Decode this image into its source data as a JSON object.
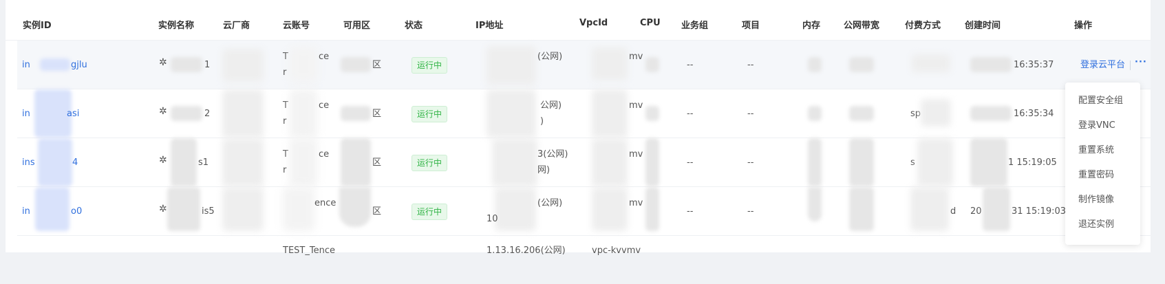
{
  "columns": {
    "instance_id": "实例ID",
    "instance_name": "实例名称",
    "cloud_vendor": "云厂商",
    "cloud_account": "云账号",
    "zone": "可用区",
    "status": "状态",
    "ip": "IP地址",
    "vpc_id": "VpcId",
    "cpu": "CPU",
    "business_group": "业务组",
    "project": "项目",
    "memory": "内存",
    "bandwidth": "公网带宽",
    "billing": "付费方式",
    "created": "创建时间",
    "actions": "操作"
  },
  "rows": [
    {
      "id": "in",
      "id_tail": "gjlu",
      "name_tail": "1",
      "account_top": "T",
      "account_top_tail": "ce",
      "account_bottom": "r",
      "zone_tail": "区",
      "status": "运行中",
      "ip_line1_tail": "(公网)",
      "ip_line2": "",
      "vpc_line1_tail": "mv",
      "vpc_line2": "",
      "business_group": "--",
      "project": "--",
      "billing_prefix": "",
      "created_prefix": "",
      "created_tail": "16:35:37",
      "action_label": "登录云平台"
    },
    {
      "id": "in",
      "id_tail": "asi",
      "name_tail": "2",
      "account_top": "T",
      "account_top_tail": "ce",
      "account_bottom": "r",
      "zone_tail": "区",
      "status": "运行中",
      "ip_line1_tail": "公网)",
      "ip_line2": ")",
      "vpc_line1_tail": "mv",
      "vpc_line2": "",
      "business_group": "--",
      "project": "--",
      "billing_prefix": "sp",
      "created_prefix": "",
      "created_tail": "16:35:34",
      "action_label": ""
    },
    {
      "id": "ins",
      "id_tail": "4",
      "name_tail": "s1",
      "account_top": "T",
      "account_top_tail": "ce",
      "account_bottom": "r",
      "zone_tail": "区",
      "status": "运行中",
      "ip_line1_tail": "3(公网)",
      "ip_line2": "网)",
      "vpc_line1_tail": "mv",
      "vpc_line2": "",
      "business_group": "--",
      "project": "--",
      "billing_prefix": "s",
      "created_prefix": "",
      "created_tail": "1 15:19:05",
      "action_label": ""
    },
    {
      "id": "in",
      "id_tail": "o0",
      "name_tail": "is5",
      "account_top": "",
      "account_top_tail": "ence",
      "account_bottom": "",
      "zone_tail": "区",
      "status": "运行中",
      "ip_line1_tail": "(公网)",
      "ip_line2": "10",
      "vpc_line1_tail": "mv",
      "vpc_line2": "",
      "business_group": "--",
      "project": "--",
      "billing_prefix": "d",
      "created_prefix": "20",
      "created_tail": "31 15:19:03",
      "action_label": ""
    }
  ],
  "partial_row": {
    "account": "TEST_Tence",
    "ip": "1.13.16.206(公网)",
    "vpc": "vpc-kvvmv"
  },
  "dropdown": {
    "items": [
      "配置安全组",
      "登录VNC",
      "重置系统",
      "重置密码",
      "制作镜像",
      "退还实例"
    ]
  },
  "more_label": "···",
  "colors": {
    "link": "#2f6fde",
    "status_running_bg": "#e8f8ea",
    "status_running_fg": "#2fb344",
    "row_hover_bg": "#f5f7fa"
  }
}
